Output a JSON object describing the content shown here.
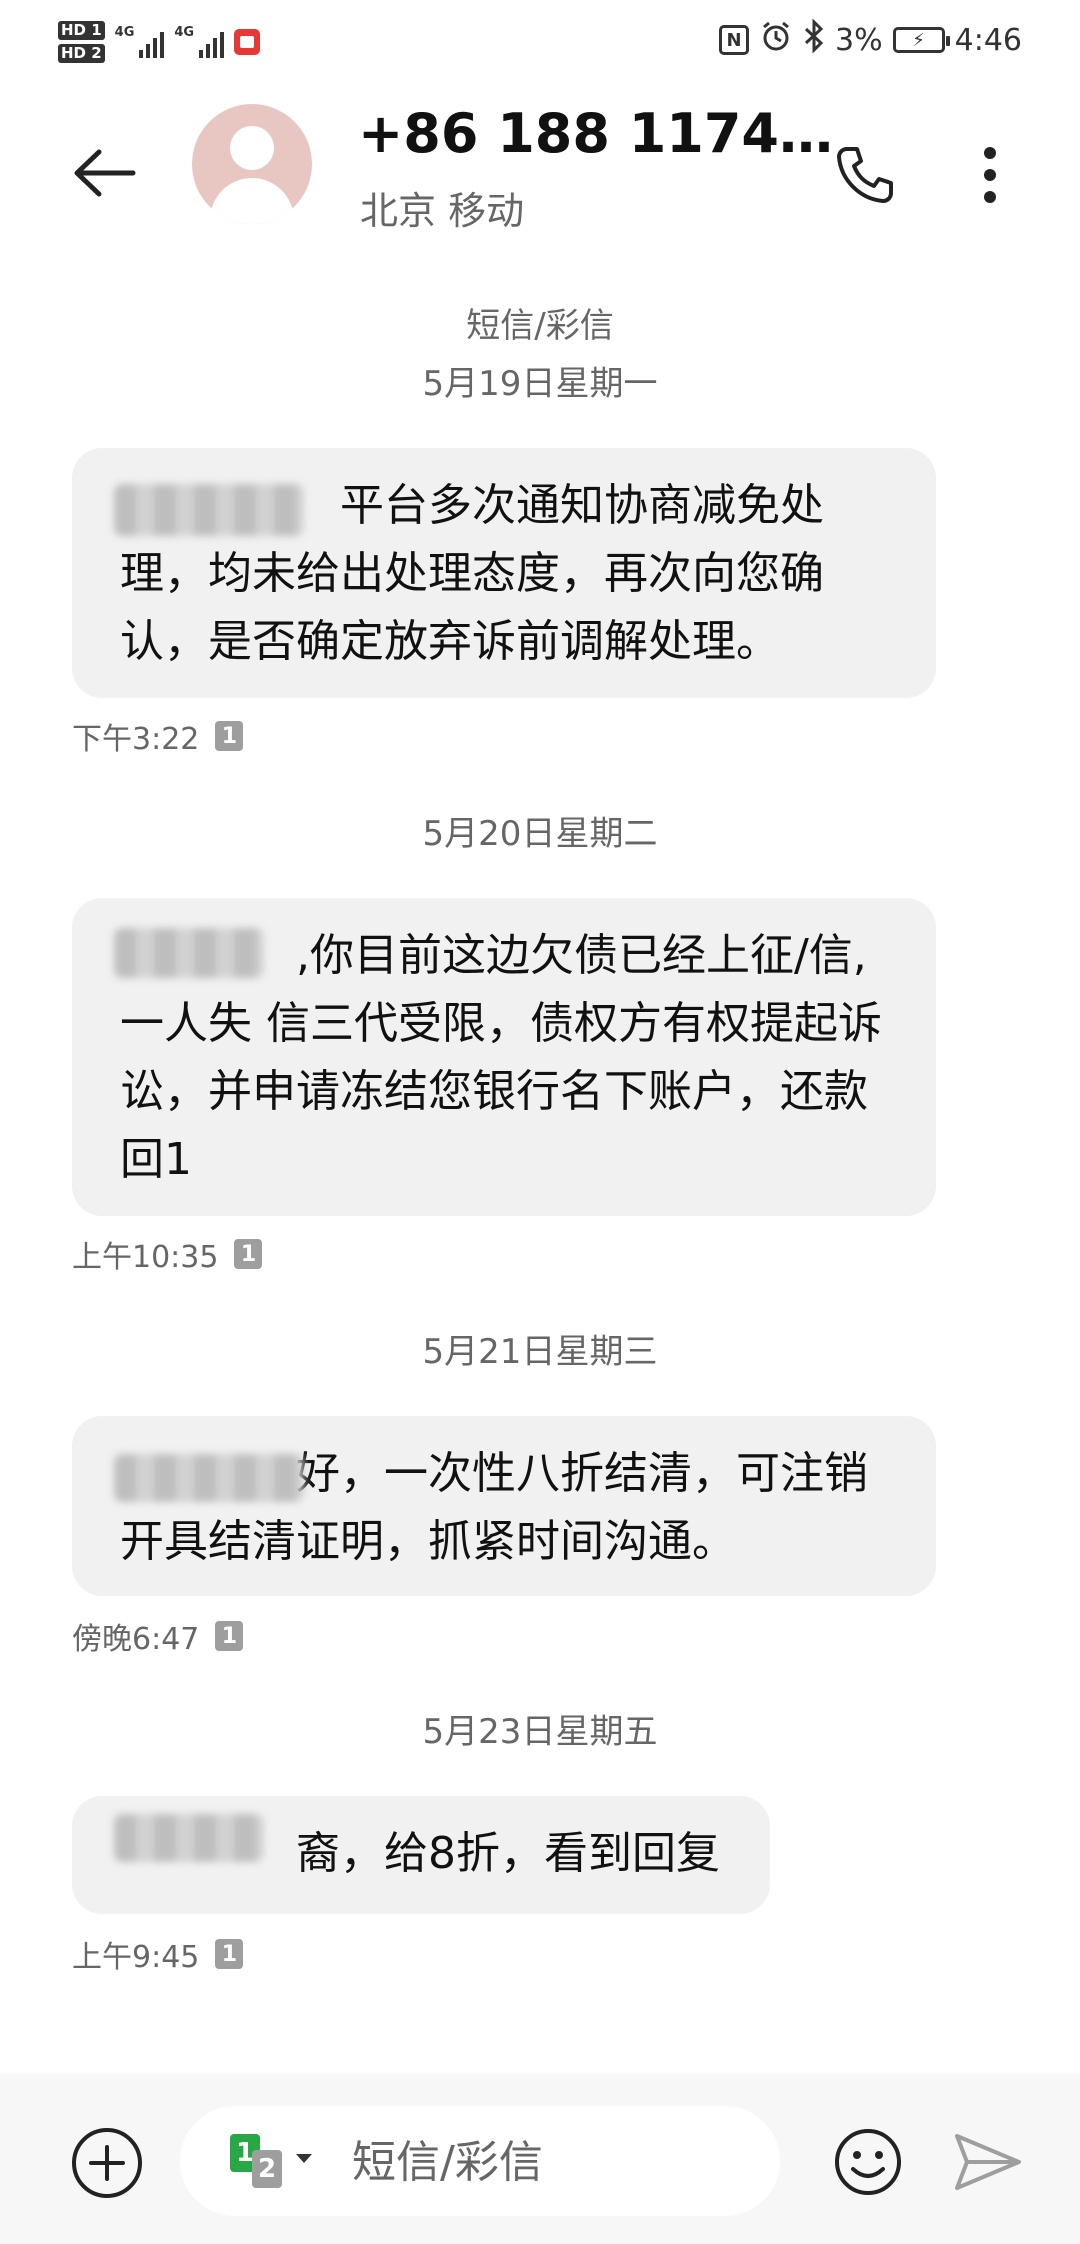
{
  "status_bar": {
    "hd1": "HD 1",
    "hd2": "HD 2",
    "net1": "4G",
    "net2": "4G",
    "battery_percent": "3%",
    "time": "4:46",
    "icons": [
      "nfc-icon",
      "alarm-icon",
      "bluetooth-icon",
      "battery-charging-icon"
    ]
  },
  "header": {
    "contact_name": "+86 188 1174…",
    "carrier": "北京 移动"
  },
  "conversation": {
    "service_type": "短信/彩信",
    "groups": [
      {
        "date": "5月19日星期一",
        "message": "　　　　　平台多次通知协商减免处理，均未给出处理态度，再次向您确认，是否确定放弃诉前调解处理。",
        "time": "下午3:22",
        "sim": "1"
      },
      {
        "date": "5月20日星期二",
        "message": "　　　　,你目前这边欠债已经上征/信,一人失 信三代受限，债权方有权提起诉讼，并申请冻结您银行名下账户，还款回1",
        "time": "上午10:35",
        "sim": "1"
      },
      {
        "date": "5月21日星期三",
        "message": "　　　　好，一次性八折结清，可注销开具结清证明，抓紧时间沟通。",
        "time": "傍晚6:47",
        "sim": "1"
      },
      {
        "date": "5月23日星期五",
        "message": "　　　　裔，给8折，看到回复",
        "time": "上午9:45",
        "sim": "1"
      }
    ]
  },
  "input_bar": {
    "placeholder": "短信/彩信",
    "sim_primary": "1",
    "sim_secondary": "2"
  }
}
